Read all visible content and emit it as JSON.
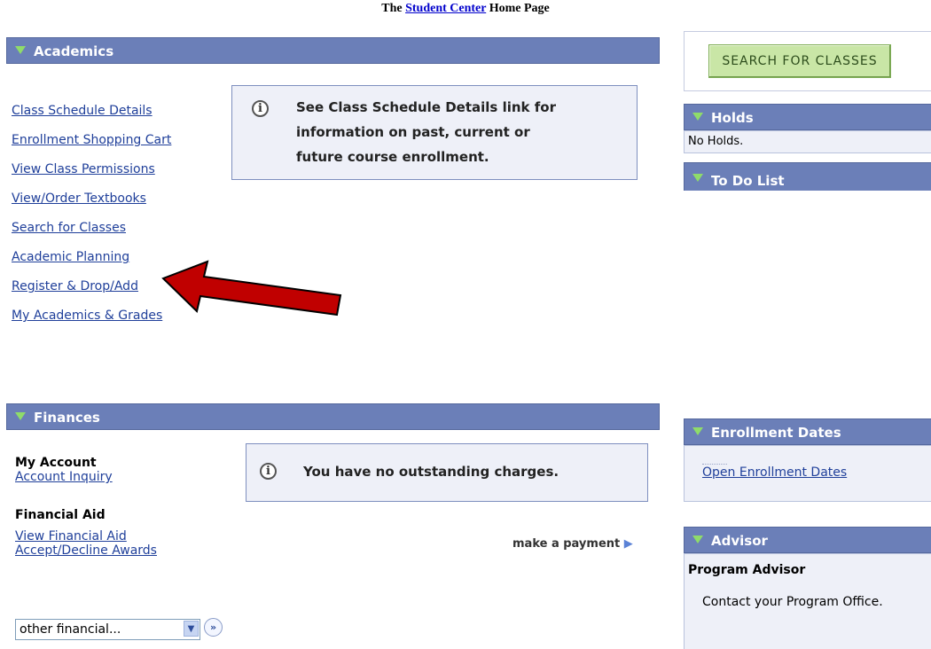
{
  "caption": {
    "prefix": "The",
    "link": "Student Center",
    "suffix": "Home Page"
  },
  "academics": {
    "title": "Academics",
    "links": [
      "Class Schedule Details",
      "Enrollment Shopping Cart",
      "View Class Permissions",
      "View/Order Textbooks",
      "Search for Classes",
      "Academic Planning",
      "Register & Drop/Add",
      "My Academics & Grades"
    ],
    "info": {
      "line1": "See Class Schedule Details link for",
      "line2": "information on past, current or",
      "line3": "future course enrollment."
    }
  },
  "search_button": {
    "label": "SEARCH FOR CLASSES"
  },
  "holds": {
    "title": "Holds",
    "text": "No Holds."
  },
  "todo": {
    "title": "To Do List"
  },
  "finances": {
    "title": "Finances",
    "my_account": {
      "heading": "My Account",
      "link": "Account Inquiry"
    },
    "financial_aid": {
      "heading": "Financial Aid",
      "links": [
        "View Financial Aid",
        "Accept/Decline Awards"
      ]
    },
    "info_text": "You have no outstanding charges.",
    "make_payment": "make a payment",
    "select_value": "other financial..."
  },
  "enrollment_dates": {
    "title": "Enrollment Dates",
    "link": "Open Enrollment Dates"
  },
  "advisor": {
    "title": "Advisor",
    "heading": "Program Advisor",
    "text": "Contact your Program Office."
  },
  "annotation": {
    "color": "#c00000",
    "target": "Register & Drop/Add"
  },
  "colors": {
    "header_bar": "#6b7fb8",
    "triangle": "#8fdc6a",
    "link": "#1f3f9a",
    "info_bg": "#eef0f8"
  },
  "icons": {
    "collapse": "triangle-down-icon",
    "info": "info-circle-icon",
    "payment": "play-arrow-icon",
    "go": "double-chevron-right-icon"
  }
}
